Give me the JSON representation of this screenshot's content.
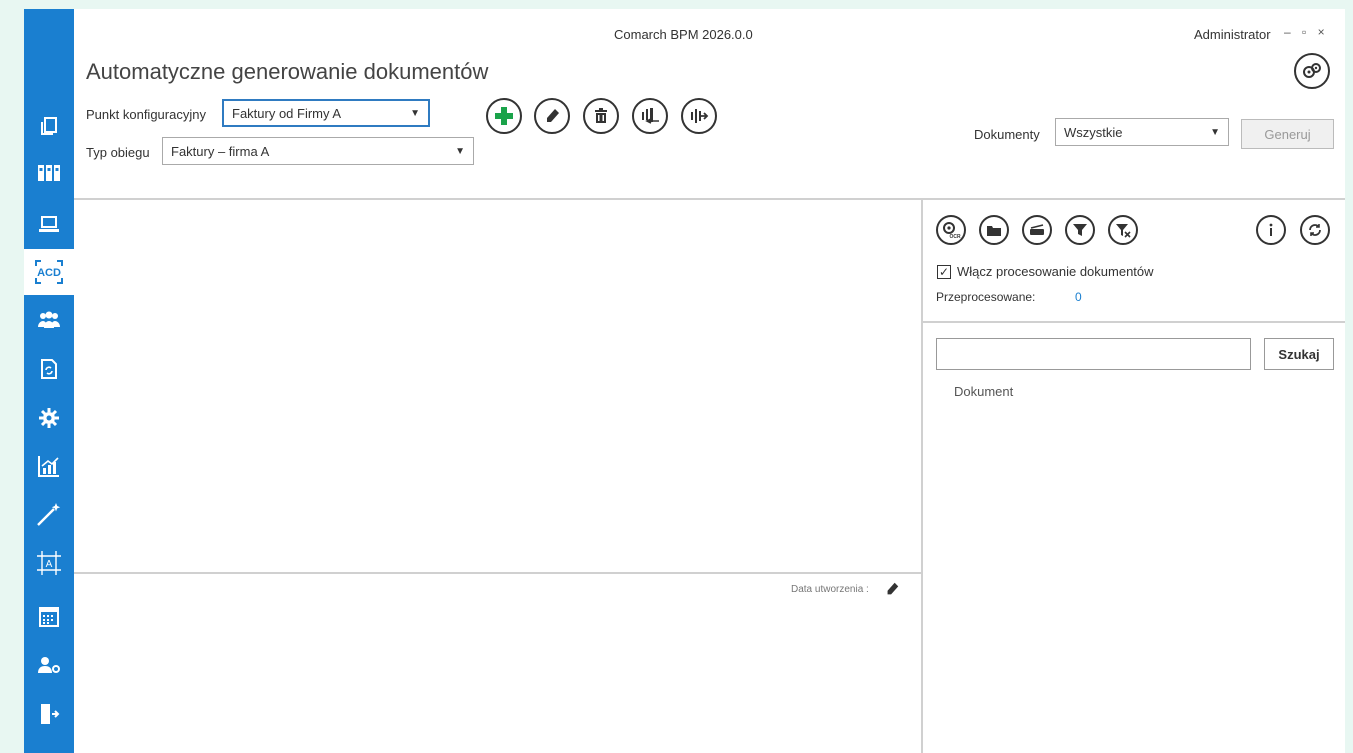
{
  "window": {
    "title": "Comarch BPM 2026.0.0",
    "user": "Administrator",
    "controls": "– ▫ ×"
  },
  "header": {
    "page_title": "Automatyczne generowanie dokumentów",
    "config_point_label": "Punkt konfiguracyjny",
    "config_point_value": "Faktury od Firmy A",
    "workflow_type_label": "Typ obiegu",
    "workflow_type_value": "Faktury – firma A",
    "documents_label": "Dokumenty",
    "documents_value": "Wszystkie",
    "generate_label": "Generuj"
  },
  "toolbar": {
    "icons": [
      "add-icon",
      "edit-icon",
      "delete-icon",
      "import-icon",
      "export-icon"
    ],
    "accent_color": "#1aa34a"
  },
  "bottom_panel": {
    "created_label": "Data utworzenia :"
  },
  "right_panel": {
    "icons": [
      "ocr-icon",
      "folder-icon",
      "scanner-icon",
      "filter-icon",
      "clear-filter-icon",
      "info-icon",
      "refresh-icon"
    ],
    "processing_checkbox_label": "Włącz procesowanie dokumentów",
    "processing_checked": true,
    "processed_label": "Przeprocesowane:",
    "processed_count": "0",
    "processed_color": "#1a7fd0",
    "search_value": "",
    "search_button": "Szukaj",
    "column_header": "Dokument"
  },
  "sidebar": {
    "color": "#1a7fd0",
    "items": [
      {
        "icon": "copy-icon"
      },
      {
        "icon": "binders-icon"
      },
      {
        "icon": "laptop-icon"
      },
      {
        "icon": "ocr-acd-icon",
        "label": "ACD"
      },
      {
        "icon": "users-icon"
      },
      {
        "icon": "document-sync-icon"
      },
      {
        "icon": "gear-icon"
      },
      {
        "icon": "chart-icon"
      },
      {
        "icon": "magic-wand-icon"
      },
      {
        "icon": "crop-text-icon",
        "label": "A"
      },
      {
        "icon": "calendar-icon"
      },
      {
        "icon": "user-settings-icon"
      },
      {
        "icon": "exit-icon"
      }
    ]
  }
}
